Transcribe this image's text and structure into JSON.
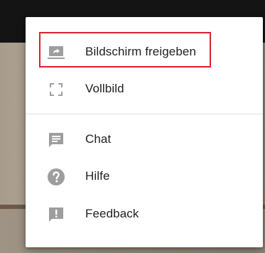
{
  "menu": {
    "items": [
      {
        "label": "Bildschirm freigeben",
        "icon": "screen-share-icon",
        "highlighted": true
      },
      {
        "label": "Vollbild",
        "icon": "fullscreen-icon"
      },
      {
        "label": "Chat",
        "icon": "chat-icon"
      },
      {
        "label": "Hilfe",
        "icon": "help-icon"
      },
      {
        "label": "Feedback",
        "icon": "feedback-icon"
      }
    ]
  },
  "colors": {
    "icon": "#9e9e9e",
    "text": "#212121",
    "highlight_border": "#d9232e",
    "divider": "#e0e0e0",
    "menu_background": "#ffffff"
  }
}
